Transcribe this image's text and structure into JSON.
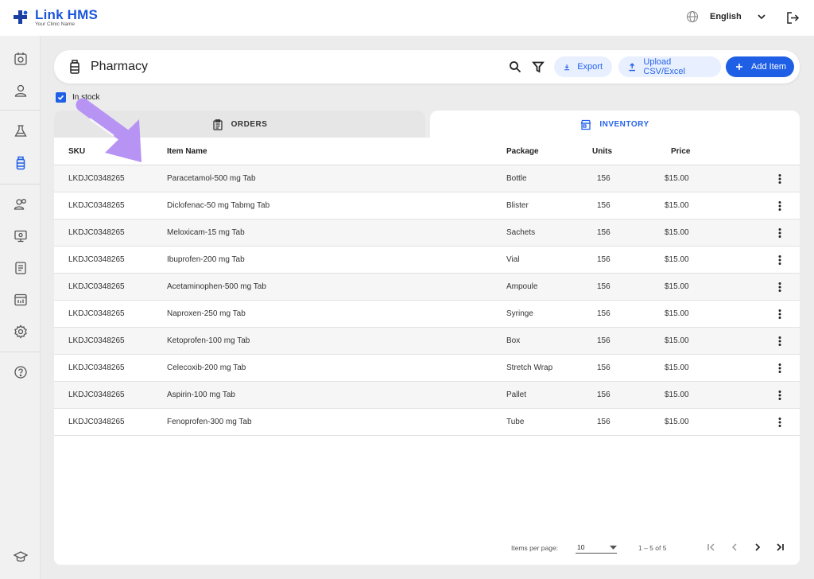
{
  "brand": {
    "name": "Link HMS",
    "tagline": "Your Clinic Name",
    "accent": "#1f5fe6"
  },
  "topbar": {
    "language": "English"
  },
  "sidebar": {
    "items": [
      "calendar-icon",
      "user-icon",
      "lab-flask-icon",
      "pharmacy-bottle-icon",
      "patients-icon",
      "monitor-icon",
      "report-icon",
      "analytics-icon",
      "settings-icon",
      "help-icon",
      "graduation-cap-icon"
    ],
    "active": "pharmacy-bottle-icon"
  },
  "header": {
    "title": "Pharmacy",
    "export_label": "Export",
    "upload_label": "Upload CSV/Excel",
    "add_label": "Add Item"
  },
  "filter": {
    "in_stock_label": "In stock",
    "in_stock_checked": true
  },
  "tabs": {
    "orders": "ORDERS",
    "inventory": "INVENTORY",
    "active": "inventory"
  },
  "table": {
    "columns": {
      "sku": "SKU",
      "item": "Item Name",
      "package": "Package",
      "units": "Units",
      "price": "Price"
    },
    "rows": [
      {
        "sku": "LKDJC0348265",
        "item": "Paracetamol-500 mg Tab",
        "package": "Bottle",
        "units": "156",
        "price": "$15.00"
      },
      {
        "sku": "LKDJC0348265",
        "item": "Diclofenac-50 mg Tabmg Tab",
        "package": "Blister",
        "units": "156",
        "price": "$15.00"
      },
      {
        "sku": "LKDJC0348265",
        "item": "Meloxicam-15 mg Tab",
        "package": "Sachets",
        "units": "156",
        "price": "$15.00"
      },
      {
        "sku": "LKDJC0348265",
        "item": "Ibuprofen-200 mg Tab",
        "package": "Vial",
        "units": "156",
        "price": "$15.00"
      },
      {
        "sku": "LKDJC0348265",
        "item": "Acetaminophen-500 mg Tab",
        "package": "Ampoule",
        "units": "156",
        "price": "$15.00"
      },
      {
        "sku": "LKDJC0348265",
        "item": "Naproxen-250 mg Tab",
        "package": "Syringe",
        "units": "156",
        "price": "$15.00"
      },
      {
        "sku": "LKDJC0348265",
        "item": "Ketoprofen-100 mg Tab",
        "package": "Box",
        "units": "156",
        "price": "$15.00"
      },
      {
        "sku": "LKDJC0348265",
        "item": "Celecoxib-200 mg Tab",
        "package": "Stretch Wrap",
        "units": "156",
        "price": "$15.00"
      },
      {
        "sku": "LKDJC0348265",
        "item": "Aspirin-100 mg Tab",
        "package": "Pallet",
        "units": "156",
        "price": "$15.00"
      },
      {
        "sku": "LKDJC0348265",
        "item": "Fenoprofen-300 mg Tab",
        "package": "Tube",
        "units": "156",
        "price": "$15.00"
      }
    ]
  },
  "pagination": {
    "items_per_page_label": "Items per page:",
    "items_per_page": "10",
    "range": "1 – 5 of 5"
  },
  "annotation": {
    "arrow_color": "#b794f4"
  }
}
